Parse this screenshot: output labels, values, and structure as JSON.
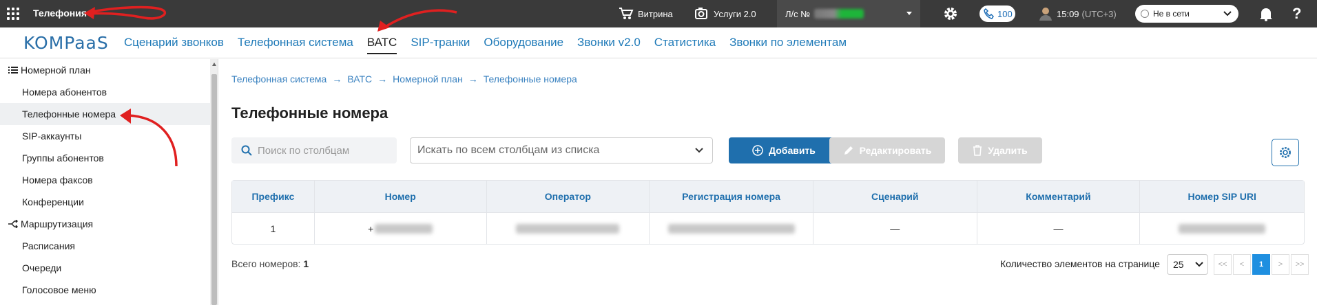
{
  "topbar": {
    "app_title": "Телефония",
    "showcase_label": "Витрина",
    "services_label": "Услуги 2.0",
    "account_label": "Л/с №",
    "calls_count": "100",
    "time": "15:09",
    "timezone": "(UTC+3)",
    "status": "Не в сети"
  },
  "nav": {
    "logo": "KOMPaaS",
    "tabs": [
      {
        "label": "Сценарий звонков"
      },
      {
        "label": "Телефонная система"
      },
      {
        "label": "ВАТС",
        "active": true
      },
      {
        "label": "SIP-транки"
      },
      {
        "label": "Оборудование"
      },
      {
        "label": "Звонки v2.0"
      },
      {
        "label": "Статистика"
      },
      {
        "label": "Звонки по элементам"
      }
    ]
  },
  "sidebar": {
    "items": [
      {
        "label": "Номерной план",
        "type": "head"
      },
      {
        "label": "Номера абонентов"
      },
      {
        "label": "Телефонные номера",
        "active": true
      },
      {
        "label": "SIP-аккаунты"
      },
      {
        "label": "Группы абонентов"
      },
      {
        "label": "Номера факсов"
      },
      {
        "label": "Конференции"
      },
      {
        "label": "Маршрутизация",
        "type": "head"
      },
      {
        "label": "Расписания"
      },
      {
        "label": "Очереди"
      },
      {
        "label": "Голосовое меню"
      }
    ]
  },
  "breadcrumb": [
    "Телефонная система",
    "ВАТС",
    "Номерной план",
    "Телефонные номера"
  ],
  "page_title": "Телефонные номера",
  "search": {
    "placeholder": "Поиск по столбцам"
  },
  "filter": {
    "placeholder": "Искать по всем столбцам из списка"
  },
  "buttons": {
    "add": "Добавить",
    "edit": "Редактировать",
    "delete": "Удалить"
  },
  "table": {
    "columns": [
      "Префикс",
      "Номер",
      "Оператор",
      "Регистрация номера",
      "Сценарий",
      "Комментарий",
      "Номер SIP URI"
    ],
    "rows": [
      {
        "prefix": "1",
        "number_prefix": "+",
        "scenario": "—",
        "comment": "—"
      }
    ]
  },
  "footer": {
    "total_label": "Всего номеров:",
    "total_value": "1",
    "per_page_label": "Количество элементов на странице",
    "per_page_value": "25",
    "pages": [
      "<<",
      "<",
      "1",
      ">",
      ">>"
    ]
  },
  "colors": {
    "accent": "#1f6fad",
    "topbar": "#3a3a3a",
    "annotation_arrow": "#e02020"
  }
}
